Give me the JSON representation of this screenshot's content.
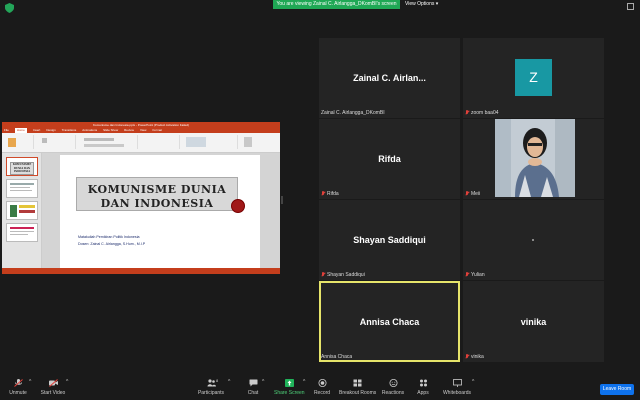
{
  "topbar": {
    "banner": "You are viewing Zainal C. Airlangga_DKomBI's screen",
    "view_options": "View Options"
  },
  "shared_screen": {
    "window_title": "Komunisme dan Indonesia.pptx - PowerPoint (Product Activation Failed)",
    "tabs": [
      "File",
      "Home",
      "Insert",
      "Design",
      "Transitions",
      "Animations",
      "Slide Show",
      "Review",
      "View",
      "Format"
    ],
    "slide": {
      "title_line1": "KOMUNISME DUNIA",
      "title_line2": "DAN INDONESIA",
      "subtitle1": "Matakuliah Pemikiran Politik Indonesia",
      "subtitle2": "Dosen: Zainal C. Airlangga, S.Hum., M.I.P"
    },
    "thumb_heading": "KOMUNISME DUNIA DAN INDONESIA"
  },
  "participants": [
    {
      "display": "Zainal C. Airlan...",
      "label": "Zainal C. Airlangga_DKomBI",
      "muted": false
    },
    {
      "display": "Z",
      "label": "zoom baa04",
      "muted": true,
      "avatar_color": "#1898a3"
    },
    {
      "display": "Rifda",
      "label": "Rifda",
      "muted": true
    },
    {
      "display": "",
      "label": "Meii",
      "muted": true
    },
    {
      "display": "Shayan Saddiqui",
      "label": "Shayan Saddiqui",
      "muted": true
    },
    {
      "display": "",
      "label": "Yulian",
      "muted": true
    },
    {
      "display": "Annisa Chaca",
      "label": "Annisa Chaca",
      "muted": false,
      "speaking": true
    },
    {
      "display": "vinika",
      "label": "vinika",
      "muted": true
    }
  ],
  "toolbar": {
    "unmute": "Unmute",
    "start_video": "Start Video",
    "participants": "Participants",
    "participants_count": "8",
    "chat": "Chat",
    "share_screen": "Share Screen",
    "record": "Record",
    "breakout_rooms": "Breakout Rooms",
    "reactions": "Reactions",
    "apps": "Apps",
    "whiteboards": "Whiteboards",
    "leave": "Leave Room"
  },
  "colors": {
    "accent_share": "#20b35a",
    "leave": "#0e72ed",
    "speaker_highlight": "#e6e46a",
    "powerpoint": "#c43e1c"
  }
}
